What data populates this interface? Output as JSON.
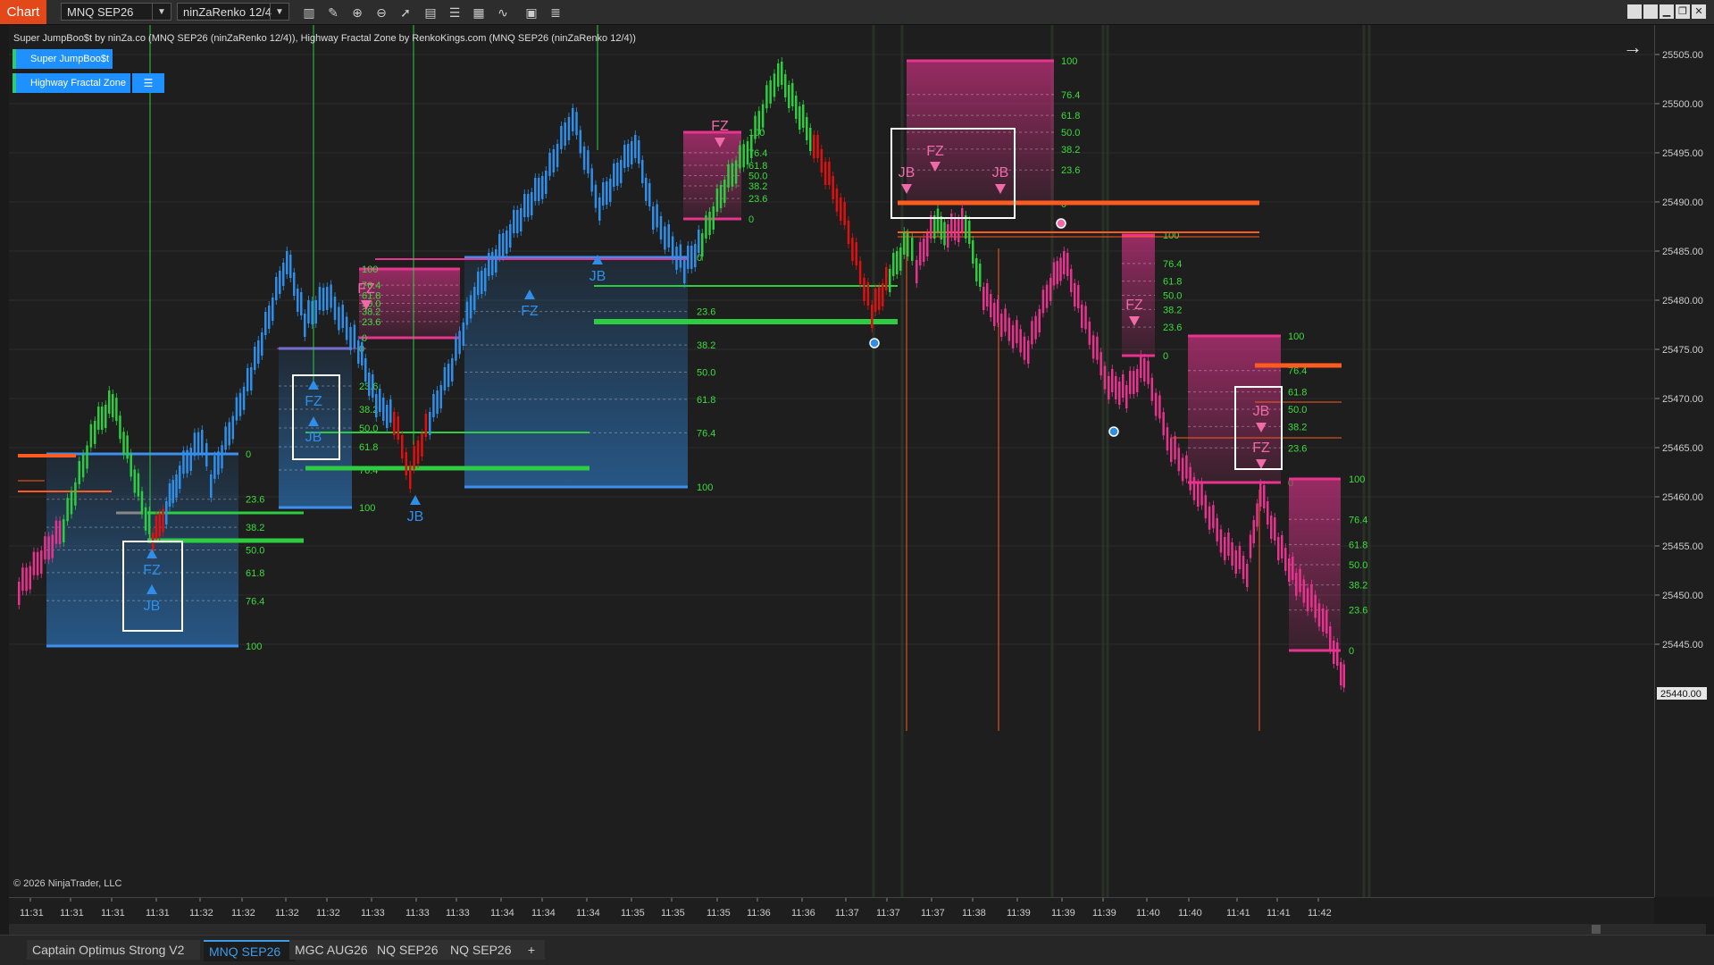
{
  "app": {
    "badge": "Chart"
  },
  "toolbar": {
    "instrument": "MNQ SEP26",
    "bar_type": "ninZaRenko 12/4",
    "icons": [
      "bar-type-icon",
      "draw-pencil-icon",
      "zoom-in-icon",
      "zoom-out-icon",
      "pointer-icon",
      "data-box-icon",
      "properties-icon",
      "strategies-icon",
      "indicators-icon",
      "templates-icon"
    ]
  },
  "legend": {
    "text": "Super JumpBoo$t by ninZa.co (MNQ SEP26 (ninZaRenko 12/4)), Highway Fractal Zone by RenkoKings.com (MNQ SEP26 (ninZaRenko 12/4))",
    "buttons": [
      {
        "label": "Super JumpBoo$t"
      },
      {
        "label": "Highway Fractal Zone",
        "menu": "☰"
      }
    ]
  },
  "copyright": "© 2026 NinjaTrader, LLC",
  "price_axis": {
    "labels": [
      "25505.00",
      "25500.00",
      "25495.00",
      "25490.00",
      "25485.00",
      "25480.00",
      "25475.00",
      "25470.00",
      "25465.00",
      "25460.00",
      "25455.00",
      "25450.00",
      "25445.00"
    ],
    "current_price": "25440.00"
  },
  "time_axis": {
    "labels": [
      "11:31",
      "11:31",
      "11:31",
      "11:31",
      "11:32",
      "11:32",
      "11:32",
      "11:32",
      "11:33",
      "11:33",
      "11:33",
      "11:34",
      "11:34",
      "11:34",
      "11:35",
      "11:35",
      "11:35",
      "11:36",
      "11:36",
      "11:37",
      "11:37",
      "11:37",
      "11:38",
      "11:39",
      "11:39",
      "11:39",
      "11:40",
      "11:40",
      "11:41",
      "11:41",
      "11:42"
    ]
  },
  "fib_levels": [
    "0",
    "23.6",
    "38.2",
    "50.0",
    "61.8",
    "76.4",
    "100"
  ],
  "signals": {
    "fz": "FZ",
    "jb": "JB"
  },
  "tabs": [
    {
      "label": "Captain Optimus Strong V2"
    },
    {
      "label": "MNQ SEP26",
      "active": true
    },
    {
      "label": "MGC AUG26"
    },
    {
      "label": "NQ SEP26"
    },
    {
      "label": "NQ SEP26"
    },
    {
      "label": "+"
    }
  ],
  "colors": {
    "bull_bar": "#2ecc40",
    "bear_bar": "#e01010",
    "blue_bar": "#2f8fe8",
    "pink_bar": "#e8338f",
    "zone_pink": "#c0307a",
    "zone_blue": "#2a5a8a",
    "fib_text": "#3ddc3d"
  }
}
